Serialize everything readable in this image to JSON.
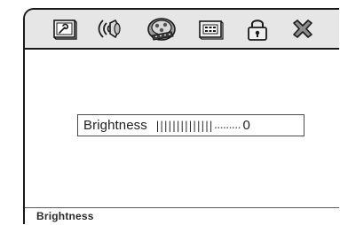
{
  "tabs": [
    {
      "icon": "general-setup-icon",
      "active": false
    },
    {
      "icon": "audio-speaker-icon",
      "active": false
    },
    {
      "icon": "video-reel-icon",
      "active": true
    },
    {
      "icon": "preference-panel-icon",
      "active": false
    },
    {
      "icon": "password-lock-icon",
      "active": false
    },
    {
      "icon": "exit-icon",
      "active": false
    }
  ],
  "setting": {
    "label": "Brightness",
    "ticks": "||||||||||||||",
    "dots": ".........",
    "value": "0",
    "level": 0.6
  },
  "status": {
    "text": "Brightness"
  },
  "colors": {
    "tabbar_bg": "#e6e6e6",
    "frame": "#1a1a1a",
    "text": "#1f1f1f"
  }
}
